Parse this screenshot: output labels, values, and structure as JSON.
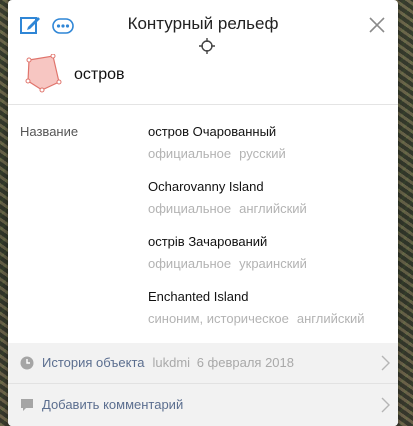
{
  "header": {
    "title": "Контурный рельеф"
  },
  "feature": {
    "name": "остров"
  },
  "properties": {
    "label": "Название",
    "names": [
      {
        "value": "остров Очарованный",
        "meta": [
          "официальное",
          "русский"
        ]
      },
      {
        "value": "Ocharovanny Island",
        "meta": [
          "официальное",
          "английский"
        ]
      },
      {
        "value": "острів Зачарований",
        "meta": [
          "официальное",
          "украинский"
        ]
      },
      {
        "value": "Enchanted Island",
        "meta": [
          "синоним, историческое",
          "английский"
        ]
      }
    ]
  },
  "history": {
    "label": "История объекта",
    "user": "lukdmi",
    "date": "6 февраля 2018"
  },
  "comment": {
    "label": "Добавить комментарий"
  },
  "colors": {
    "accent": "#2f86d6",
    "polygon_fill": "#f7c6c2",
    "polygon_stroke": "#e0746c"
  },
  "icons": {
    "edit": "edit-icon",
    "more": "more-icon",
    "close": "close-icon",
    "center": "crosshair-icon",
    "history": "clock-icon",
    "comment": "comment-icon",
    "chevron": "chevron-right-icon"
  }
}
